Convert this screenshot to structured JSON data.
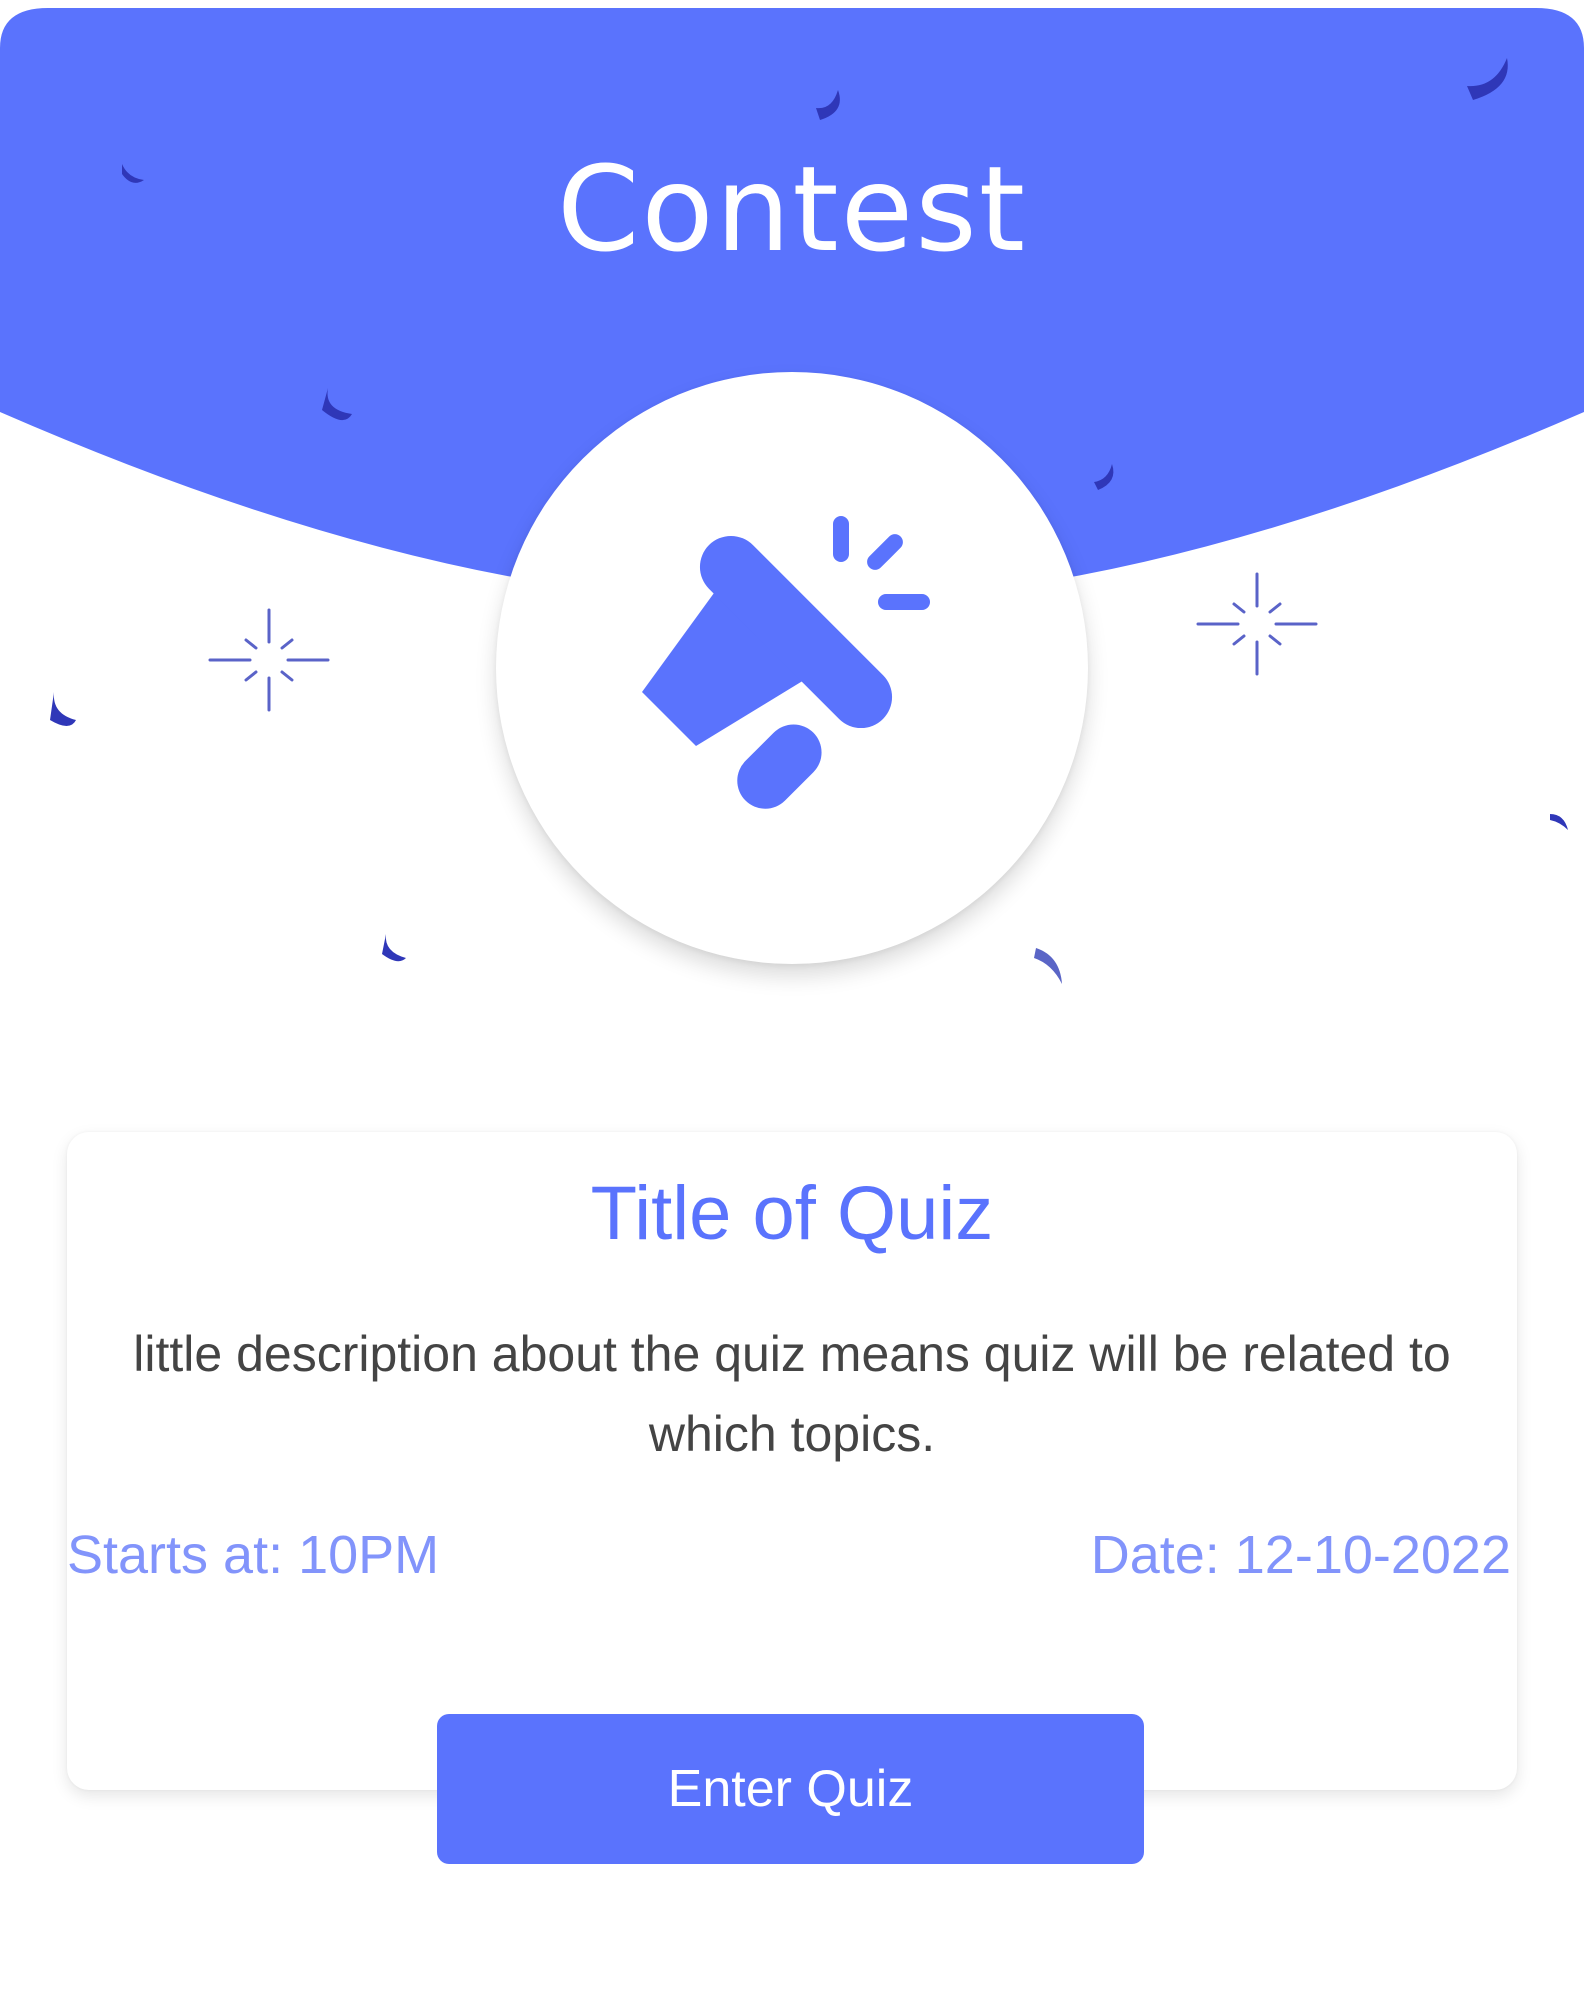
{
  "header": {
    "title": "Contest",
    "icon": "megaphone-icon"
  },
  "colors": {
    "accent": "#5A73FD",
    "confetti": "#2F37B8",
    "meta_text": "#8294FB",
    "body_text": "#444444"
  },
  "quiz": {
    "title": "Title of Quiz",
    "description": "little description about the quiz means quiz will be related to which topics.",
    "starts_at": "Starts at: 10PM",
    "date": "Date: 12-10-2022",
    "button_label": "Enter Quiz"
  }
}
